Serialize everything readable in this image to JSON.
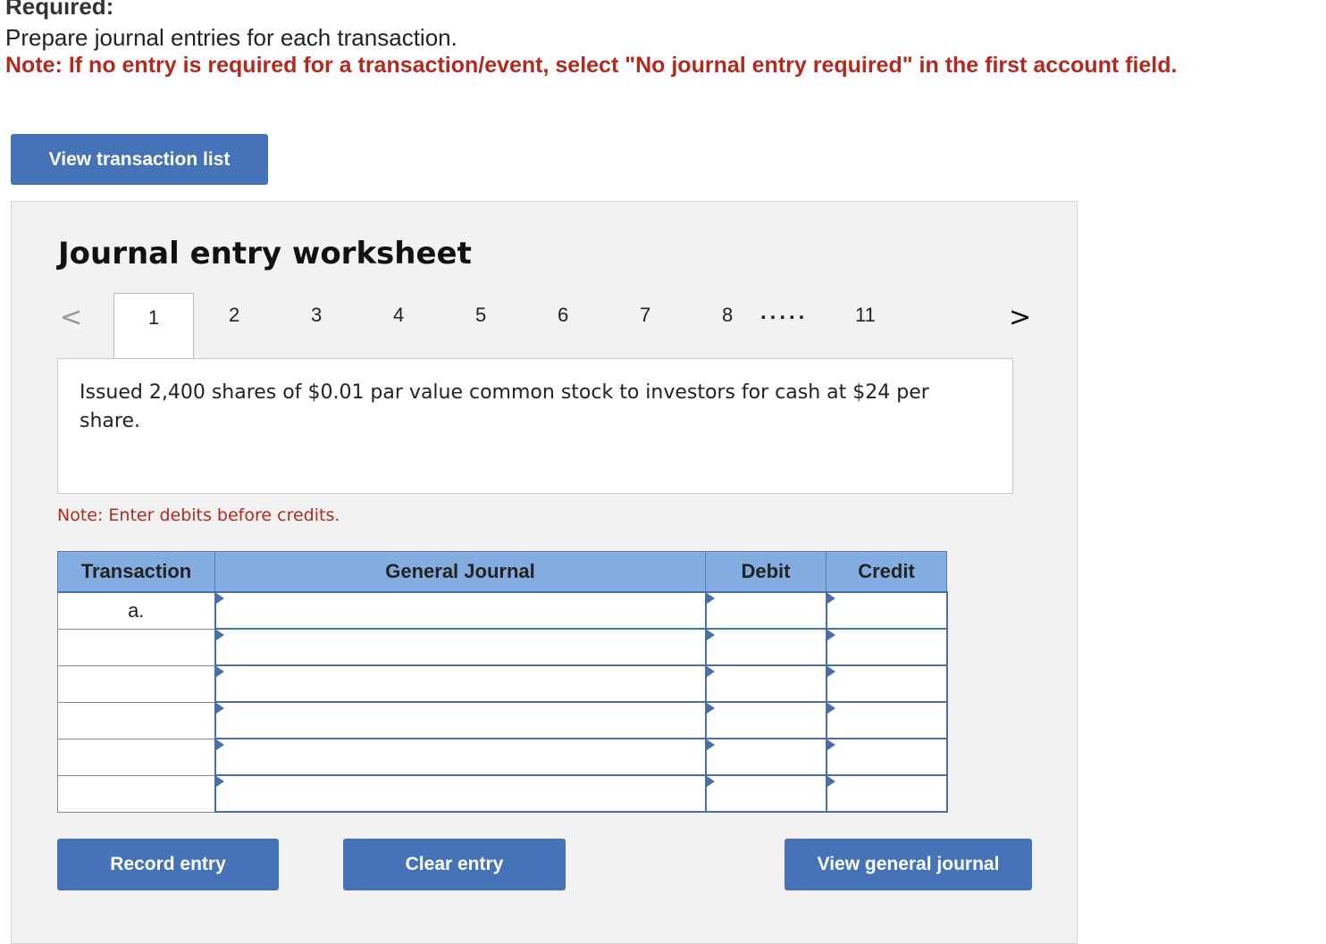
{
  "header": {
    "required": "Required:",
    "instructions": "Prepare journal entries for each transaction.",
    "note": "Note: If no entry is required for a transaction/event, select \"No journal entry required\" in the first account field."
  },
  "buttons": {
    "view_transaction_list": "View transaction list",
    "record_entry": "Record entry",
    "clear_entry": "Clear entry",
    "view_general_journal": "View general journal"
  },
  "worksheet": {
    "title": "Journal entry worksheet",
    "pager": {
      "prev_icon": "chevron-left-icon",
      "next_icon": "chevron-right-icon",
      "prev_glyph": "<",
      "next_glyph": ">",
      "tabs": [
        "1",
        "2",
        "3",
        "4",
        "5",
        "6",
        "7",
        "8"
      ],
      "ellipsis": ".....",
      "last_tab": "11",
      "active": "1"
    },
    "description": "Issued 2,400 shares of $0.01 par value common stock to investors for cash at $24 per share.",
    "note": "Note: Enter debits before credits."
  },
  "journal_table": {
    "headers": [
      "Transaction",
      "General Journal",
      "Debit",
      "Credit"
    ],
    "rows": [
      {
        "transaction": "a.",
        "account": "",
        "debit": "",
        "credit": ""
      },
      {
        "transaction": "",
        "account": "",
        "debit": "",
        "credit": ""
      },
      {
        "transaction": "",
        "account": "",
        "debit": "",
        "credit": ""
      },
      {
        "transaction": "",
        "account": "",
        "debit": "",
        "credit": ""
      },
      {
        "transaction": "",
        "account": "",
        "debit": "",
        "credit": ""
      },
      {
        "transaction": "",
        "account": "",
        "debit": "",
        "credit": ""
      }
    ]
  },
  "colors": {
    "accent": "#4673b7",
    "header_bg": "#83ace0",
    "note_red": "#b22a1f",
    "panel_bg": "#f2f2f2"
  }
}
